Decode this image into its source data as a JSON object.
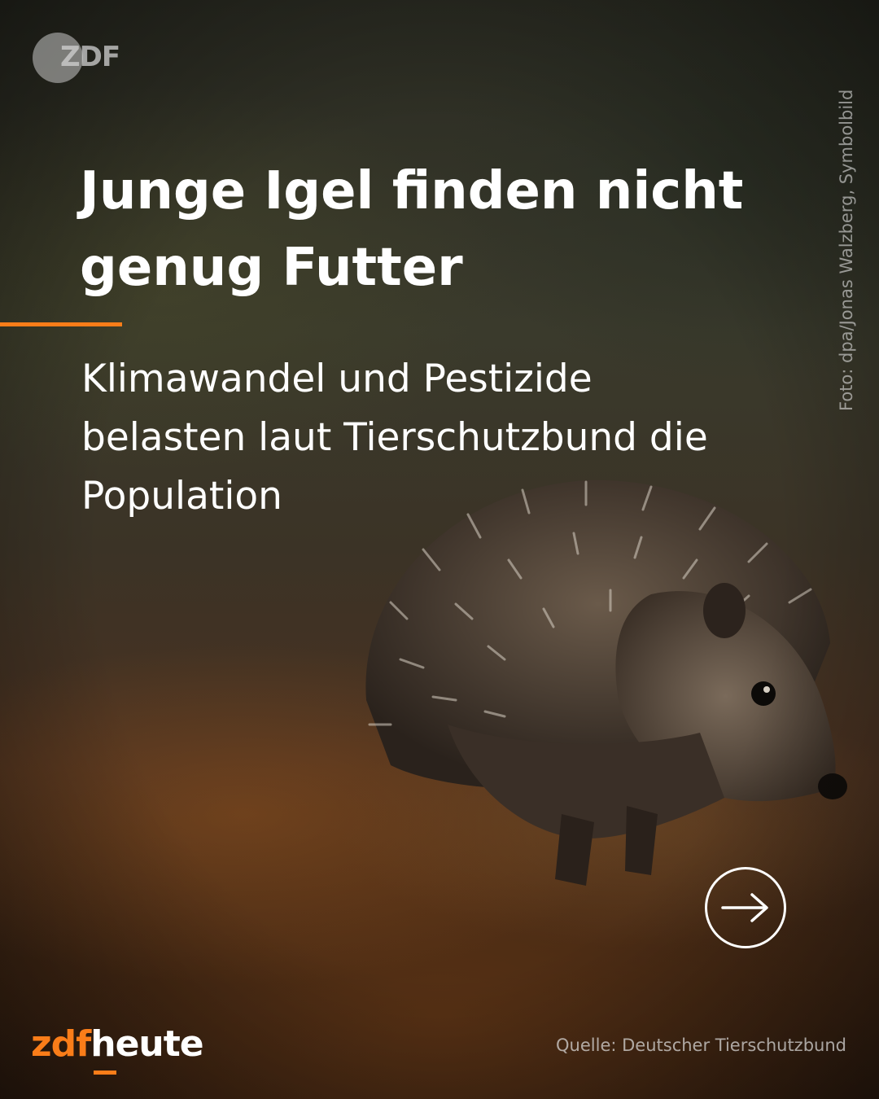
{
  "branding": {
    "top_logo": "ZDF",
    "bottom_logo_prefix": "zdf",
    "bottom_logo_suffix": "heute",
    "accent_color": "#fa7d19"
  },
  "headline": "Junge Igel finden nicht genug Futter",
  "subline": "Klimawandel und Pestizide belasten laut Tierschutzbund die Population",
  "photo_credit": "Foto: dpa/Jonas Walzberg, Symbolbild",
  "source": "Quelle: Deutscher Tierschutzbund",
  "icons": {
    "next": "arrow-right-circle-icon",
    "photo": "hedgehog-illustration"
  }
}
